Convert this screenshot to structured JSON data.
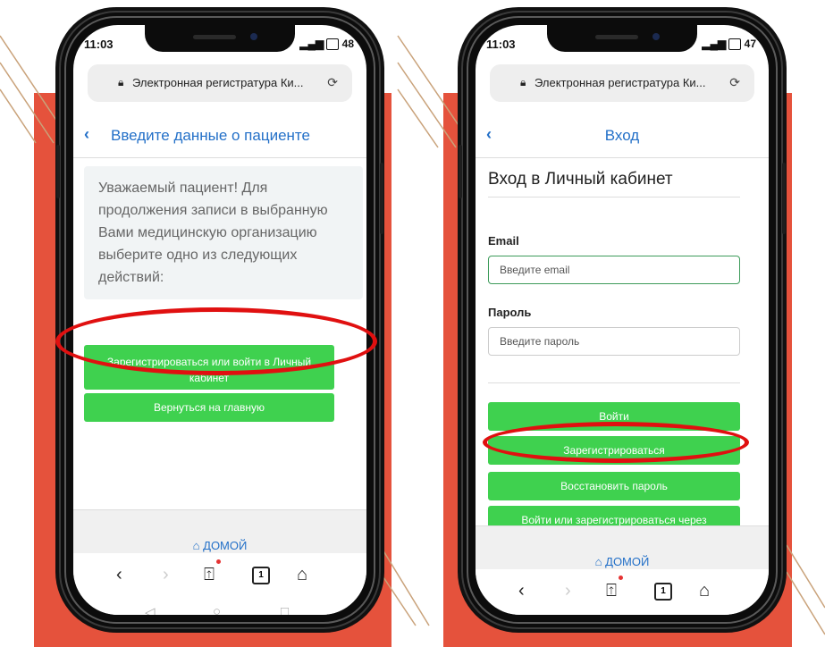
{
  "colors": {
    "accent_red": "#e5523c",
    "link_blue": "#2370c8",
    "button_green": "#3fd14f",
    "highlight_red": "#e01010"
  },
  "left_phone": {
    "status": {
      "time": "11:03",
      "right": "48"
    },
    "url": "Электронная регистратура Ки...",
    "nav_title": "Введите данные о пациенте",
    "info_text": "Уважаемый пациент! Для продолжения записи в выбранную Вами медицинскую организацию выберите одно из следующих действий:",
    "register_button": "Зарегистрироваться или войти в Личный кабинет",
    "home_button": "Вернуться на главную",
    "footer": "ДОМОЙ",
    "tab_count": "1"
  },
  "right_phone": {
    "status": {
      "time": "11:03",
      "right": "47"
    },
    "url": "Электронная регистратура Ки...",
    "nav_title": "Вход",
    "heading": "Вход в Личный кабинет",
    "email_label": "Email",
    "email_placeholder": "Введите email",
    "password_label": "Пароль",
    "password_placeholder": "Введите пароль",
    "login_button": "Войти",
    "register_button": "Зарегистрироваться",
    "restore_button": "Восстановить пароль",
    "via_button": "Войти или зарегистрироваться через",
    "footer": "ДОМОЙ",
    "tab_count": "1"
  }
}
